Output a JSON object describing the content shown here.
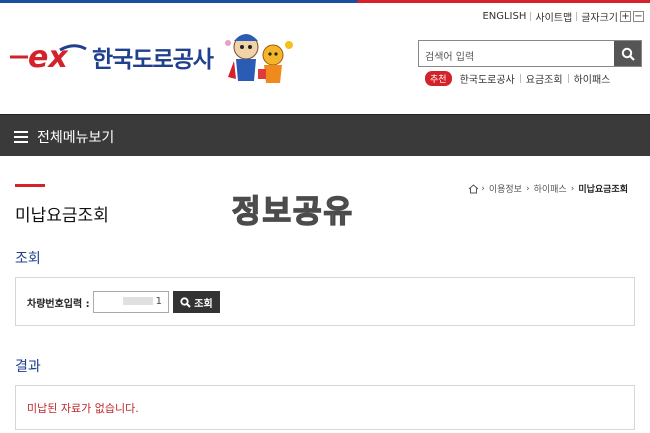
{
  "util_links": {
    "english": "ENGLISH",
    "sitemap": "사이트맵",
    "font_size": "글자크기",
    "plus": "+",
    "minus": "−"
  },
  "brand": {
    "name": "한국도로공사",
    "mark": "ex"
  },
  "search": {
    "placeholder": "검색어 입력"
  },
  "recommend": {
    "badge": "추천",
    "items": [
      "한국도로공사",
      "요금조회",
      "하이패스"
    ]
  },
  "nav": {
    "all_menu": "전체메뉴보기"
  },
  "page": {
    "title": "미납요금조회"
  },
  "breadcrumb": [
    "이용정보",
    "하이패스",
    "미납요금조회"
  ],
  "watermark": "정보공유",
  "query_section": {
    "heading": "조회",
    "field_label": "차량번호입력 :",
    "field_value": "1",
    "button": "조회"
  },
  "result_section": {
    "heading": "결과",
    "message": "미납된 자료가 없습니다."
  },
  "colors": {
    "brand_blue": "#1f3f8f",
    "brand_red": "#d3222a",
    "nav_bg": "#3a3a3a"
  }
}
